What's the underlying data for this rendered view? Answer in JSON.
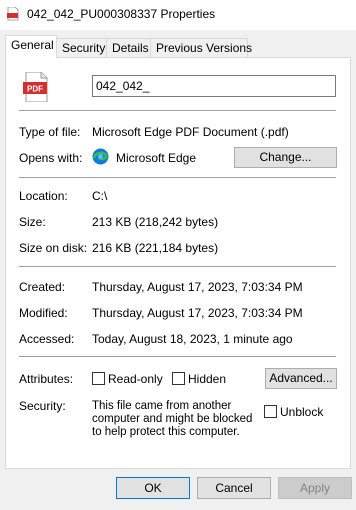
{
  "window": {
    "title": "042_042_PU000308337 Properties"
  },
  "tabs": [
    {
      "label": "General"
    },
    {
      "label": "Security"
    },
    {
      "label": "Details"
    },
    {
      "label": "Previous Versions"
    }
  ],
  "general": {
    "file_icon_label": "PDF",
    "file_name": "042_042_",
    "type_label": "Type of file:",
    "type_value": "Microsoft Edge PDF Document (.pdf)",
    "opens_label": "Opens with:",
    "opens_value": "Microsoft Edge",
    "change_button": "Change...",
    "location_label": "Location:",
    "location_value": "C:\\",
    "size_label": "Size:",
    "size_value": "213 KB (218,242 bytes)",
    "size_disk_label": "Size on disk:",
    "size_disk_value": "216 KB (221,184 bytes)",
    "created_label": "Created:",
    "created_value": "Thursday, August 17, 2023, 7:03:34 PM",
    "modified_label": "Modified:",
    "modified_value": "Thursday, August 17, 2023, 7:03:34 PM",
    "accessed_label": "Accessed:",
    "accessed_value": "Today, August 18, 2023, 1 minute ago",
    "attributes_label": "Attributes:",
    "readonly_label": "Read-only",
    "hidden_label": "Hidden",
    "advanced_button": "Advanced...",
    "security_label": "Security:",
    "security_text": "This file came from another computer and might be blocked to help protect this computer.",
    "unblock_label": "Unblock"
  },
  "footer": {
    "ok": "OK",
    "cancel": "Cancel",
    "apply": "Apply"
  },
  "colors": {
    "pdf_red": "#d32f2f",
    "edge_blue": "#0c7cd5",
    "edge_green": "#41b855",
    "accent": "#0078d7"
  }
}
